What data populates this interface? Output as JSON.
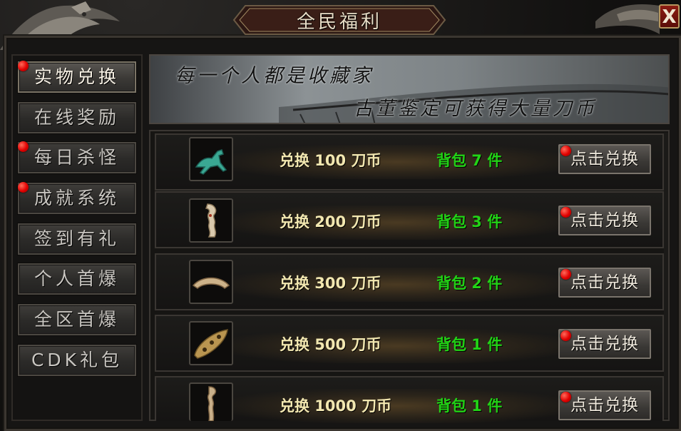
{
  "window": {
    "title": "全民福利",
    "close_label": "X"
  },
  "sidebar": {
    "items": [
      {
        "label": "实物兑换",
        "active": true,
        "badge": true
      },
      {
        "label": "在线奖励",
        "active": false,
        "badge": false
      },
      {
        "label": "每日杀怪",
        "active": false,
        "badge": true
      },
      {
        "label": "成就系统",
        "active": false,
        "badge": true
      },
      {
        "label": "签到有礼",
        "active": false,
        "badge": false
      },
      {
        "label": "个人首爆",
        "active": false,
        "badge": false
      },
      {
        "label": "全区首爆",
        "active": false,
        "badge": false
      },
      {
        "label": "CDK礼包",
        "active": false,
        "badge": false
      }
    ]
  },
  "banner": {
    "line1": "每一个人都是收藏家",
    "line2": "古董鉴定可获得大量刀币"
  },
  "rows": [
    {
      "icon": "bronze-horse-icon",
      "exchange": "兑换 100 刀币",
      "bag": "背包 7 件",
      "button": "点击兑换"
    },
    {
      "icon": "jade-dragon-pendant-icon",
      "exchange": "兑换 200 刀币",
      "bag": "背包 3 件",
      "button": "点击兑换"
    },
    {
      "icon": "jade-arc-icon",
      "exchange": "兑换 300 刀币",
      "bag": "背包 2 件",
      "button": "点击兑换"
    },
    {
      "icon": "jade-bead-icon",
      "exchange": "兑换 500 刀币",
      "bag": "背包 1 件",
      "button": "点击兑换"
    },
    {
      "icon": "jade-dragon-hook-icon",
      "exchange": "兑换 1000 刀币",
      "bag": "背包 1 件",
      "button": "点击兑换"
    }
  ],
  "colors": {
    "accent_text": "#f2e7b0",
    "count_green": "#22d316",
    "badge_red": "#e00000",
    "close_red": "#8d1c12"
  }
}
